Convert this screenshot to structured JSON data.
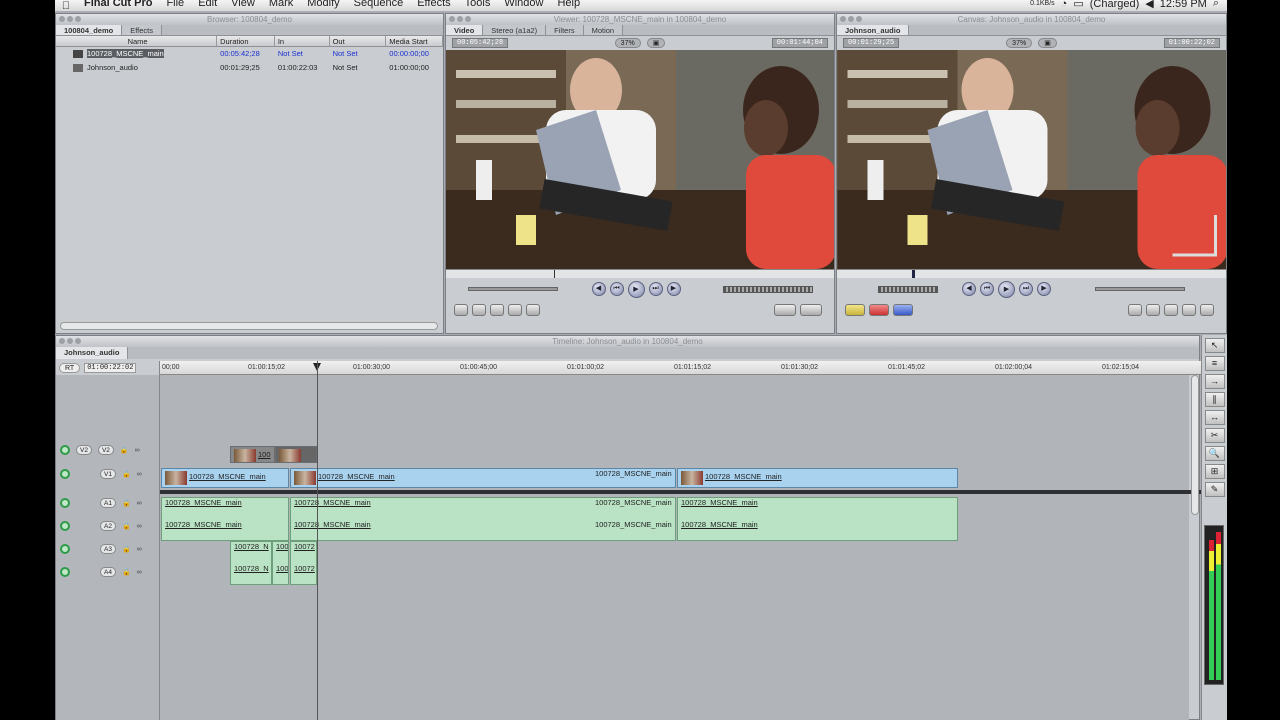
{
  "menubar": {
    "app_name": "Final Cut Pro",
    "items": [
      "File",
      "Edit",
      "View",
      "Mark",
      "Modify",
      "Sequence",
      "Effects",
      "Tools",
      "Window",
      "Help"
    ],
    "battery": "(Charged)",
    "clock": "12:59 PM",
    "netspeed": "0.1KB/s"
  },
  "browser": {
    "title": "Browser: 100804_demo",
    "tabs": [
      "100804_demo",
      "Effects"
    ],
    "columns": [
      "Name",
      "Duration",
      "In",
      "Out",
      "Media Start"
    ],
    "rows": [
      {
        "name": "100728_MSCNE_main",
        "duration": "00:05:42;28",
        "in": "Not Set",
        "out": "Not Set",
        "media_start": "00:00:00;00"
      },
      {
        "name": "Johnson_audio",
        "duration": "00:01:29;25",
        "in": "01:00:22:03",
        "out": "Not Set",
        "media_start": "01:00:00;00"
      }
    ]
  },
  "viewer": {
    "title": "Viewer: 100728_MSCNE_main in 100804_demo",
    "tabs": [
      "Video",
      "Stereo (a1a2)",
      "Filters",
      "Motion"
    ],
    "tc_duration": "00:05:42;28",
    "zoom": "37%",
    "tc_current": "00:01:44;04"
  },
  "canvas": {
    "title": "Canvas: Johnson_audio in 100804_demo",
    "tab": "Johnson_audio",
    "tc_duration": "00:01:29;25",
    "zoom": "37%",
    "tc_current": "01:00:22;02"
  },
  "timeline": {
    "title": "Timeline: Johnson_audio in 100804_demo",
    "tab": "Johnson_audio",
    "rt_label": "RT",
    "current_tc": "01:00:22:02",
    "ruler_labels": [
      "00;00",
      "01:00:15;02",
      "01:00:30;00",
      "01:00:45;00",
      "01:01:00;02",
      "01:01:15;02",
      "01:01:30;02",
      "01:01:45;02",
      "01:02:00;04",
      "01:02:15;04"
    ],
    "tracks": {
      "v2": "V2",
      "v1": "V1",
      "a1": "A1",
      "a2": "A2",
      "a3": "A3",
      "a4": "A4"
    },
    "clip_label": "100728_MSCNE_main",
    "clip_label_short": "100728_N",
    "clip_label_tiny": "100",
    "clip_label_v2": "100",
    "clip_label_a34": "10072"
  },
  "colors": {
    "video_clip": "#a9d2ef",
    "audio_clip": "#b9e3c4",
    "selection": "#5a5d62",
    "timecode_blue": "#1a2fd0"
  }
}
